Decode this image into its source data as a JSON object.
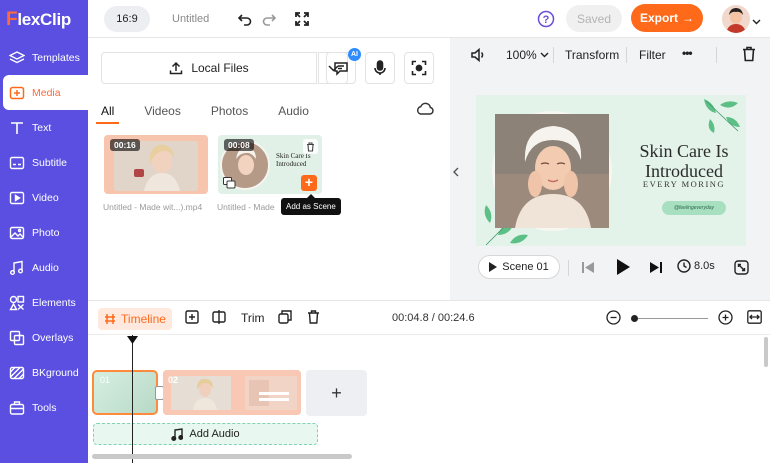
{
  "app": {
    "logo_text": "FlexClip"
  },
  "sidebar": {
    "items": [
      {
        "label": "Templates",
        "icon": "layers-icon"
      },
      {
        "label": "Media",
        "icon": "media-icon",
        "active": true
      },
      {
        "label": "Text",
        "icon": "text-icon"
      },
      {
        "label": "Subtitle",
        "icon": "subtitle-icon"
      },
      {
        "label": "Video",
        "icon": "video-icon"
      },
      {
        "label": "Photo",
        "icon": "photo-icon"
      },
      {
        "label": "Audio",
        "icon": "audio-icon"
      },
      {
        "label": "Elements",
        "icon": "elements-icon"
      },
      {
        "label": "Overlays",
        "icon": "overlays-icon"
      },
      {
        "label": "BKground",
        "icon": "background-icon"
      },
      {
        "label": "Tools",
        "icon": "tools-icon"
      }
    ]
  },
  "topbar": {
    "ratio": "16:9",
    "title": "Untitled",
    "saved_label": "Saved",
    "export_label": "Export",
    "export_arrow": "→"
  },
  "media_panel": {
    "source_label": "Local Files",
    "ai_badge": "AI",
    "tabs": [
      "All",
      "Videos",
      "Photos",
      "Audio"
    ],
    "active_tab": "All",
    "items": [
      {
        "duration": "00:16",
        "caption": "Untitled - Made wit...).mp4"
      },
      {
        "duration": "00:08",
        "caption": "Untitled - Made",
        "thumb_text_1": "Skin Care Is",
        "thumb_text_2": "Introduced"
      }
    ],
    "tooltip": "Add as Scene",
    "add_symbol": "+"
  },
  "preview": {
    "zoom": "100%",
    "transform_label": "Transform",
    "filter_label": "Filter",
    "more_label": "•••",
    "canvas_title_line1": "Skin Care Is",
    "canvas_title_line2": "Introduced",
    "canvas_subtitle": "EVERY MORING",
    "canvas_pill": "@feelingeveryday",
    "scene_label": "Scene 01",
    "duration": "8.0s"
  },
  "timeline": {
    "label": "Timeline",
    "trim_label": "Trim",
    "time": "00:04.8 / 00:24.6",
    "clips": [
      {
        "num": "01"
      },
      {
        "num": "02"
      }
    ],
    "add_clip_symbol": "+",
    "add_audio_label": "Add Audio"
  },
  "colors": {
    "sidebar": "#5a4fe0",
    "accent": "#ff6a1a"
  }
}
